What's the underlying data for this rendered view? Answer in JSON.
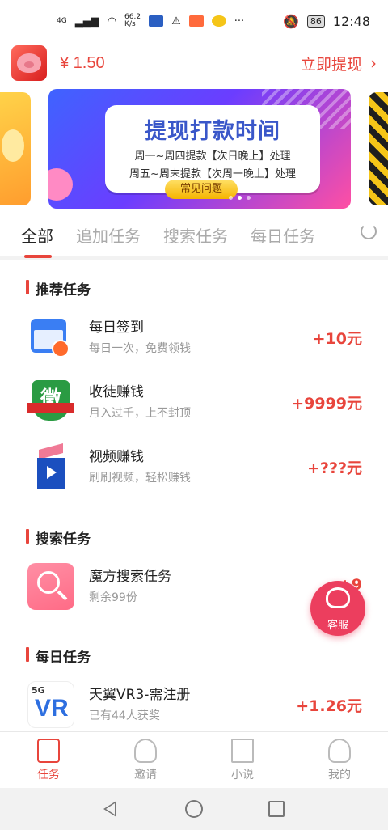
{
  "status_bar": {
    "network": "4G",
    "speed": "66.2",
    "speed_unit": "K/s",
    "battery": "86",
    "time": "12:48"
  },
  "header": {
    "balance": "¥ 1.50",
    "withdraw_label": "立即提现",
    "avatar_icon": "pig-avatar-icon"
  },
  "banner": {
    "title": "提现打款时间",
    "line1": "周一~周四提款【次日晚上】处理",
    "line2": "周五~周末提款【次周一晚上】处理",
    "button": "常见问题"
  },
  "tabs": [
    {
      "label": "全部",
      "active": true
    },
    {
      "label": "追加任务",
      "active": false
    },
    {
      "label": "搜索任务",
      "active": false
    },
    {
      "label": "每日任务",
      "active": false
    }
  ],
  "sections": {
    "recommended": {
      "title": "推荐任务",
      "tasks": [
        {
          "name": "每日签到",
          "desc": "每日一次，免费领钱",
          "reward": "+10元",
          "icon": "calendar-check-icon"
        },
        {
          "name": "收徒赚钱",
          "desc": "月入过千，上不封顶",
          "reward": "+9999元",
          "icon": "invite-shield-icon"
        },
        {
          "name": "视频赚钱",
          "desc": "刷刷视频，轻松赚钱",
          "reward": "+???元",
          "icon": "video-clapper-icon"
        }
      ]
    },
    "search": {
      "title": "搜索任务",
      "tasks": [
        {
          "name": "魔方搜索任务",
          "desc": "剩余99份",
          "reward": "+9",
          "icon": "magnifier-icon"
        }
      ]
    },
    "daily": {
      "title": "每日任务",
      "tasks": [
        {
          "name": "天翼VR3-需注册",
          "desc": "已有44人获奖",
          "reward": "+1.26元",
          "icon": "5g-vr-icon",
          "icon_text_top": "5G",
          "icon_text_main": "VR"
        }
      ]
    }
  },
  "float_button": {
    "label": "客服",
    "icon": "customer-service-icon"
  },
  "bottom_nav": [
    {
      "label": "任务",
      "active": true,
      "icon": "task-icon"
    },
    {
      "label": "邀请",
      "active": false,
      "icon": "invite-icon"
    },
    {
      "label": "小说",
      "active": false,
      "icon": "book-icon"
    },
    {
      "label": "我的",
      "active": false,
      "icon": "profile-icon"
    }
  ],
  "colors": {
    "accent": "#e8453c",
    "service": "#ec3e5e"
  }
}
